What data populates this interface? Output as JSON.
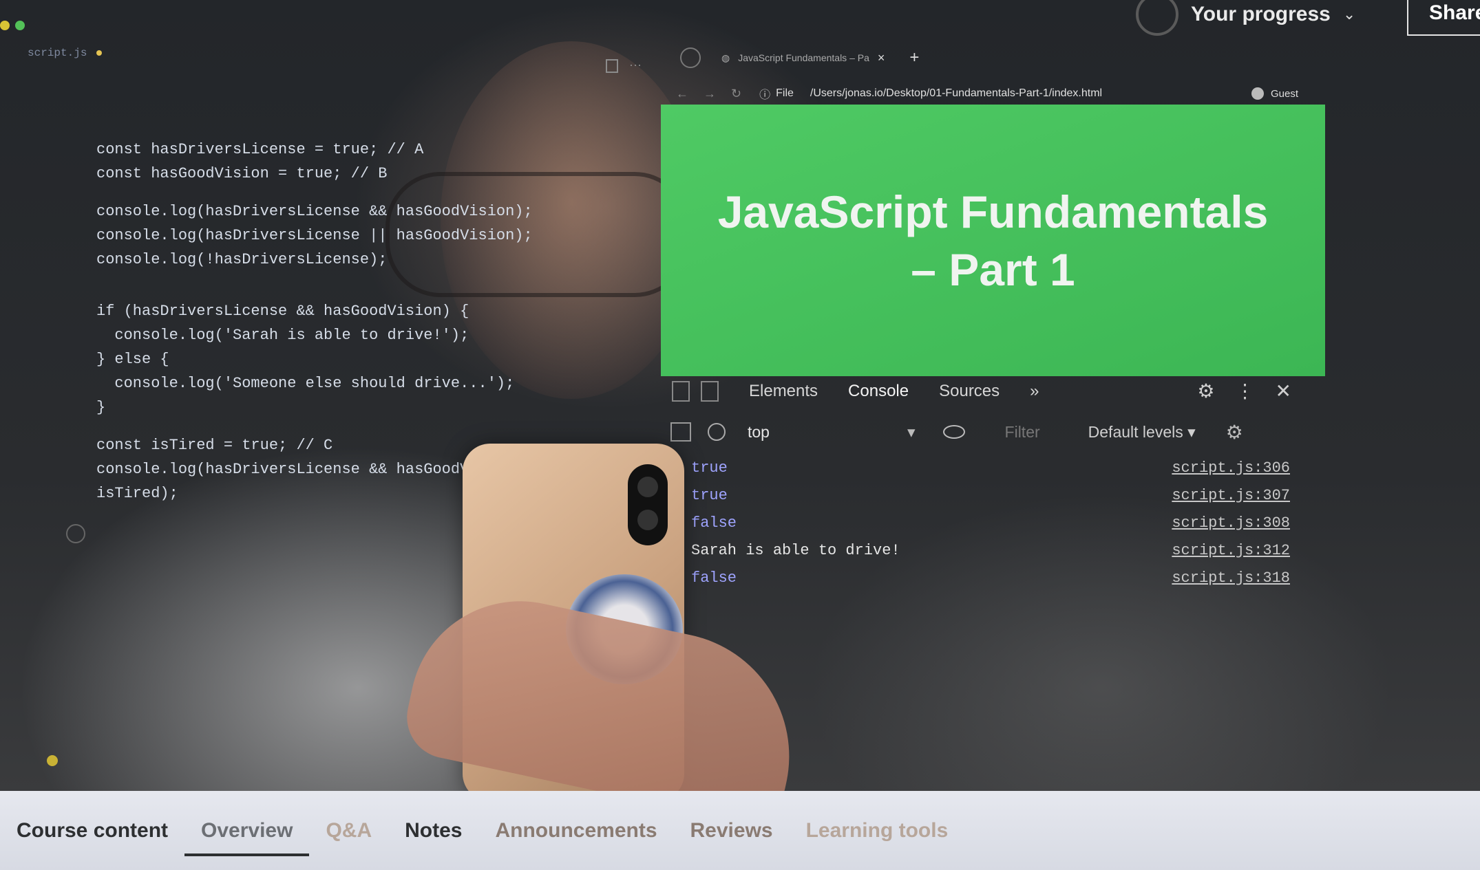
{
  "top": {
    "progress_label": "Your progress",
    "share_label": "Share"
  },
  "editor": {
    "tab_name": "script.js"
  },
  "code_lines": {
    "l1": "const hasDriversLicense = true; // A",
    "l2": "const hasGoodVision = true; // B",
    "l3": "console.log(hasDriversLicense && hasGoodVision);",
    "l4": "console.log(hasDriversLicense || hasGoodVision);",
    "l5": "console.log(!hasDriversLicense);",
    "l6": "if (hasDriversLicense && hasGoodVision) {",
    "l7": "  console.log('Sarah is able to drive!');",
    "l8": "} else {",
    "l9": "  console.log('Someone else should drive...');",
    "l10": "}",
    "l11": "const isTired = true; // C",
    "l12": "console.log(hasDriversLicense && hasGoodVision &&",
    "l13": "isTired);"
  },
  "browser": {
    "tab_title": "JavaScript Fundamentals – Pa",
    "file_label": "File",
    "url": "/Users/jonas.io/Desktop/01-Fundamentals-Part-1/index.html",
    "guest_label": "Guest",
    "page_heading": "JavaScript Fundamentals – Part 1"
  },
  "devtools": {
    "tabs": [
      "Elements",
      "Console",
      "Sources",
      "»"
    ],
    "context": "top",
    "filter_placeholder": "Filter",
    "levels": "Default levels ▾",
    "console_rows": [
      {
        "msg": "true",
        "src": "script.js:306"
      },
      {
        "msg": "true",
        "src": "script.js:307"
      },
      {
        "msg": "false",
        "src": "script.js:308"
      },
      {
        "msg": "Sarah is able to drive!",
        "src": "script.js:312"
      },
      {
        "msg": "false",
        "src": "script.js:318"
      }
    ]
  },
  "bottom_tabs": [
    "Course content",
    "Overview",
    "Q&A",
    "Notes",
    "Announcements",
    "Reviews",
    "Learning tools"
  ]
}
